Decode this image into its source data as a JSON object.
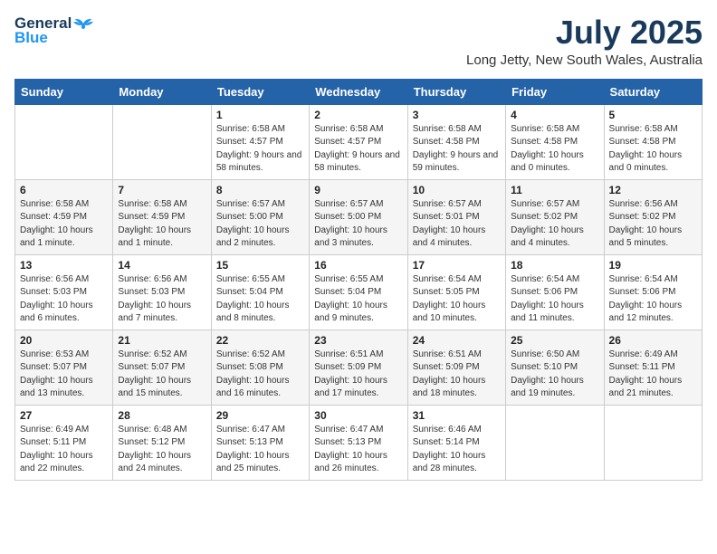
{
  "logo": {
    "general": "General",
    "blue": "Blue"
  },
  "title": "July 2025",
  "location": "Long Jetty, New South Wales, Australia",
  "days_of_week": [
    "Sunday",
    "Monday",
    "Tuesday",
    "Wednesday",
    "Thursday",
    "Friday",
    "Saturday"
  ],
  "weeks": [
    [
      {
        "day": "",
        "info": ""
      },
      {
        "day": "",
        "info": ""
      },
      {
        "day": "1",
        "info": "Sunrise: 6:58 AM\nSunset: 4:57 PM\nDaylight: 9 hours and 58 minutes."
      },
      {
        "day": "2",
        "info": "Sunrise: 6:58 AM\nSunset: 4:57 PM\nDaylight: 9 hours and 58 minutes."
      },
      {
        "day": "3",
        "info": "Sunrise: 6:58 AM\nSunset: 4:58 PM\nDaylight: 9 hours and 59 minutes."
      },
      {
        "day": "4",
        "info": "Sunrise: 6:58 AM\nSunset: 4:58 PM\nDaylight: 10 hours and 0 minutes."
      },
      {
        "day": "5",
        "info": "Sunrise: 6:58 AM\nSunset: 4:58 PM\nDaylight: 10 hours and 0 minutes."
      }
    ],
    [
      {
        "day": "6",
        "info": "Sunrise: 6:58 AM\nSunset: 4:59 PM\nDaylight: 10 hours and 1 minute."
      },
      {
        "day": "7",
        "info": "Sunrise: 6:58 AM\nSunset: 4:59 PM\nDaylight: 10 hours and 1 minute."
      },
      {
        "day": "8",
        "info": "Sunrise: 6:57 AM\nSunset: 5:00 PM\nDaylight: 10 hours and 2 minutes."
      },
      {
        "day": "9",
        "info": "Sunrise: 6:57 AM\nSunset: 5:00 PM\nDaylight: 10 hours and 3 minutes."
      },
      {
        "day": "10",
        "info": "Sunrise: 6:57 AM\nSunset: 5:01 PM\nDaylight: 10 hours and 4 minutes."
      },
      {
        "day": "11",
        "info": "Sunrise: 6:57 AM\nSunset: 5:02 PM\nDaylight: 10 hours and 4 minutes."
      },
      {
        "day": "12",
        "info": "Sunrise: 6:56 AM\nSunset: 5:02 PM\nDaylight: 10 hours and 5 minutes."
      }
    ],
    [
      {
        "day": "13",
        "info": "Sunrise: 6:56 AM\nSunset: 5:03 PM\nDaylight: 10 hours and 6 minutes."
      },
      {
        "day": "14",
        "info": "Sunrise: 6:56 AM\nSunset: 5:03 PM\nDaylight: 10 hours and 7 minutes."
      },
      {
        "day": "15",
        "info": "Sunrise: 6:55 AM\nSunset: 5:04 PM\nDaylight: 10 hours and 8 minutes."
      },
      {
        "day": "16",
        "info": "Sunrise: 6:55 AM\nSunset: 5:04 PM\nDaylight: 10 hours and 9 minutes."
      },
      {
        "day": "17",
        "info": "Sunrise: 6:54 AM\nSunset: 5:05 PM\nDaylight: 10 hours and 10 minutes."
      },
      {
        "day": "18",
        "info": "Sunrise: 6:54 AM\nSunset: 5:06 PM\nDaylight: 10 hours and 11 minutes."
      },
      {
        "day": "19",
        "info": "Sunrise: 6:54 AM\nSunset: 5:06 PM\nDaylight: 10 hours and 12 minutes."
      }
    ],
    [
      {
        "day": "20",
        "info": "Sunrise: 6:53 AM\nSunset: 5:07 PM\nDaylight: 10 hours and 13 minutes."
      },
      {
        "day": "21",
        "info": "Sunrise: 6:52 AM\nSunset: 5:07 PM\nDaylight: 10 hours and 15 minutes."
      },
      {
        "day": "22",
        "info": "Sunrise: 6:52 AM\nSunset: 5:08 PM\nDaylight: 10 hours and 16 minutes."
      },
      {
        "day": "23",
        "info": "Sunrise: 6:51 AM\nSunset: 5:09 PM\nDaylight: 10 hours and 17 minutes."
      },
      {
        "day": "24",
        "info": "Sunrise: 6:51 AM\nSunset: 5:09 PM\nDaylight: 10 hours and 18 minutes."
      },
      {
        "day": "25",
        "info": "Sunrise: 6:50 AM\nSunset: 5:10 PM\nDaylight: 10 hours and 19 minutes."
      },
      {
        "day": "26",
        "info": "Sunrise: 6:49 AM\nSunset: 5:11 PM\nDaylight: 10 hours and 21 minutes."
      }
    ],
    [
      {
        "day": "27",
        "info": "Sunrise: 6:49 AM\nSunset: 5:11 PM\nDaylight: 10 hours and 22 minutes."
      },
      {
        "day": "28",
        "info": "Sunrise: 6:48 AM\nSunset: 5:12 PM\nDaylight: 10 hours and 24 minutes."
      },
      {
        "day": "29",
        "info": "Sunrise: 6:47 AM\nSunset: 5:13 PM\nDaylight: 10 hours and 25 minutes."
      },
      {
        "day": "30",
        "info": "Sunrise: 6:47 AM\nSunset: 5:13 PM\nDaylight: 10 hours and 26 minutes."
      },
      {
        "day": "31",
        "info": "Sunrise: 6:46 AM\nSunset: 5:14 PM\nDaylight: 10 hours and 28 minutes."
      },
      {
        "day": "",
        "info": ""
      },
      {
        "day": "",
        "info": ""
      }
    ]
  ]
}
